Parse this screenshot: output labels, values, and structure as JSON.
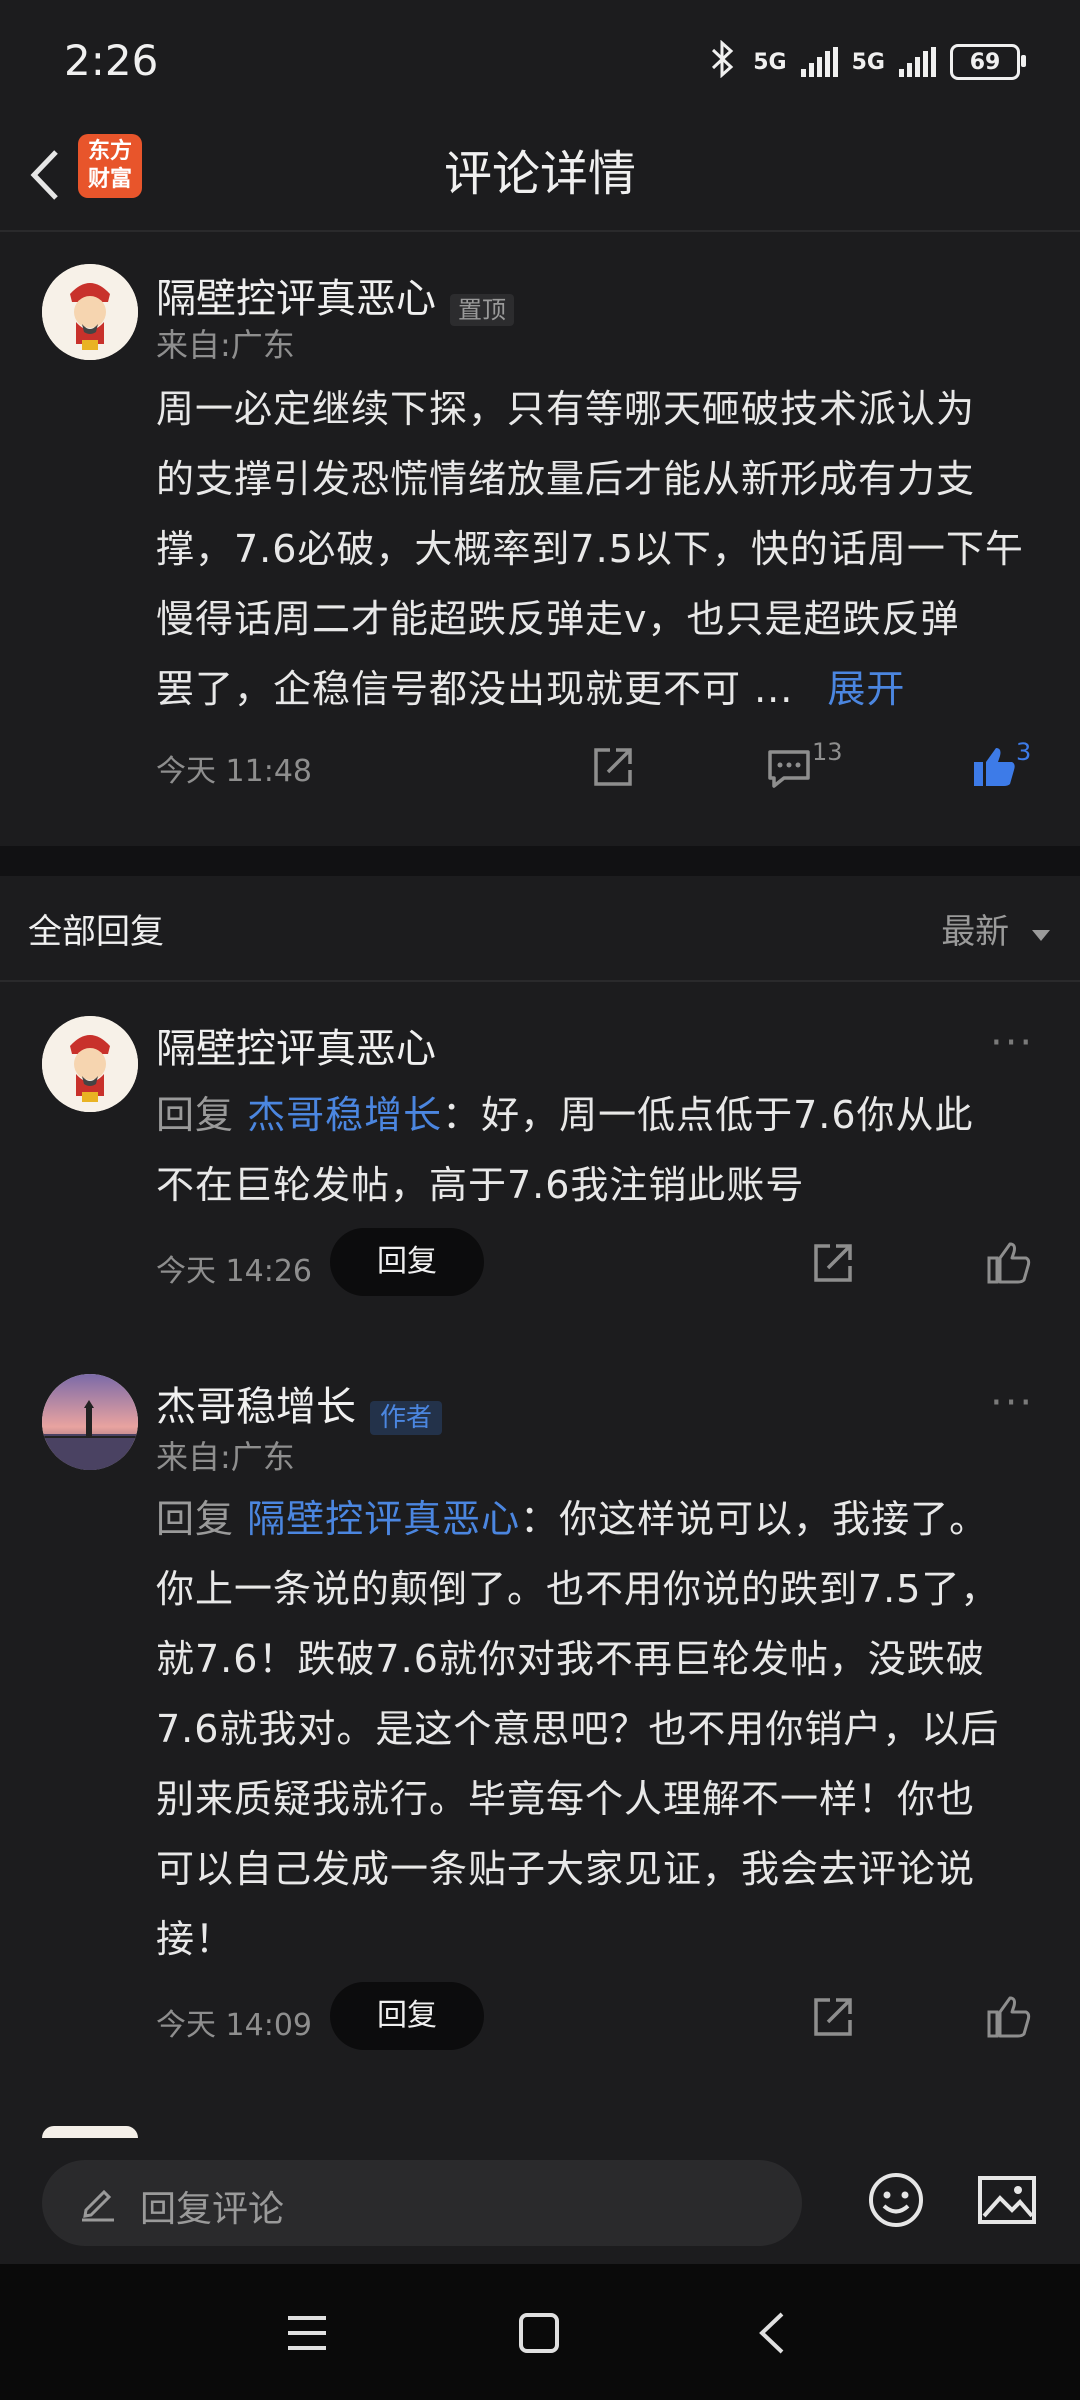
{
  "status_bar": {
    "time": "2:26",
    "network1": "5G",
    "network2": "5G",
    "battery": "69"
  },
  "header": {
    "title": "评论详情",
    "logo_text_line1": "东方",
    "logo_text_line2": "财富"
  },
  "pinned_comment": {
    "username": "隔壁控评真恶心",
    "badge": "置顶",
    "location": "来自:广东",
    "lines": [
      "周一必定继续下探，只有等哪天砸破技术派认为",
      "的支撑引发恐慌情绪放量后才能从新形成有力支",
      "撑，7.6必破，大概率到7.5以下，快的话周一下午",
      "慢得话周二才能超跌反弹走v，也只是超跌反弹",
      "罢了，企稳信号都没出现就更不可 ..."
    ],
    "expand": "展开",
    "time": "今天 11:48",
    "comment_count": "13",
    "like_count": "3"
  },
  "replies_section": {
    "title": "全部回复",
    "sort": "最新"
  },
  "replies": [
    {
      "username": "隔壁控评真恶心",
      "reply_prefix": "回复 ",
      "reply_to": "杰哥稳增长",
      "line1_rest": "：好，周一低点低于7.6你从此",
      "lines": [
        "不在巨轮发帖，高于7.6我注销此账号"
      ],
      "time": "今天 14:26",
      "reply_button": "回复"
    },
    {
      "username": "杰哥稳增长",
      "badge": "作者",
      "location": "来自:广东",
      "reply_prefix": "回复 ",
      "reply_to": "隔壁控评真恶心",
      "line1_rest": "：你这样说可以，我接了。",
      "lines": [
        "你上一条说的颠倒了。也不用你说的跌到7.5了，",
        "就7.6！跌破7.6就你对我不再巨轮发帖，没跌破",
        "7.6就我对。是这个意思吧？也不用你销户，以后",
        "别来质疑我就行。毕竟每个人理解不一样！你也",
        "可以自己发成一条贴子大家见证，我会去评论说",
        "接！"
      ],
      "time": "今天 14:09",
      "reply_button": "回复"
    }
  ],
  "bottom_bar": {
    "input_placeholder": "回复评论"
  }
}
